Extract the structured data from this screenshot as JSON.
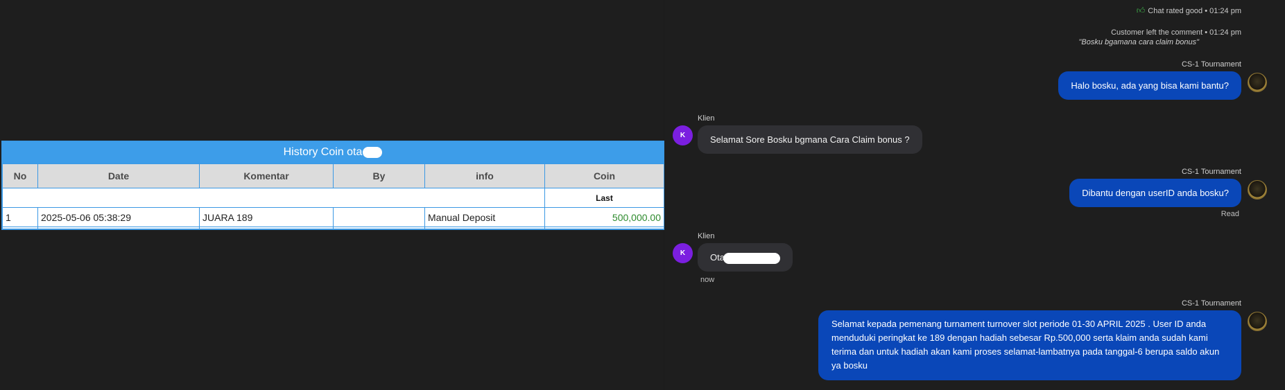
{
  "history": {
    "title": "History Coin ota",
    "columns": [
      "No",
      "Date",
      "Komentar",
      "By",
      "info",
      "Coin"
    ],
    "last_label": "Last",
    "rows": [
      {
        "no": "1",
        "date": "2025-05-06 05:38:29",
        "komentar": "JUARA 189",
        "by": "",
        "info": "Manual Deposit",
        "coin": "500,000.00"
      }
    ]
  },
  "chat": {
    "rated": "Chat rated good • 01:24 pm",
    "comment_header": "Customer left the comment • 01:24 pm",
    "comment_text": "\"Bosku bgamana cara claim bonus\"",
    "agent_name": "CS-1 Tournament",
    "client_name": "Klien",
    "client_initial": "K",
    "messages": [
      {
        "text": "Halo bosku, ada yang bisa kami bantu?"
      },
      {
        "text": "Selamat Sore Bosku bgmana Cara Claim bonus ?"
      },
      {
        "text": "Dibantu dengan userID anda bosku?"
      },
      {
        "text": "Ota"
      },
      {
        "text": "Selamat kepada pemenang turnament turnover slot periode 01-30 APRIL 2025 . User ID anda menduduki peringkat ke 189 dengan hadiah sebesar Rp.500,000 serta klaim anda sudah kami terima dan untuk hadiah akan kami proses selamat-lambatnya pada tanggal-6 berupa saldo akun ya bosku"
      }
    ],
    "read_label": "Read",
    "now_label": "now",
    "colors": {
      "agent_bubble": "#0a47b8",
      "client_bubble": "#303034",
      "avatar_client": "#7b1fe0",
      "thumb": "#3fb24a"
    }
  }
}
